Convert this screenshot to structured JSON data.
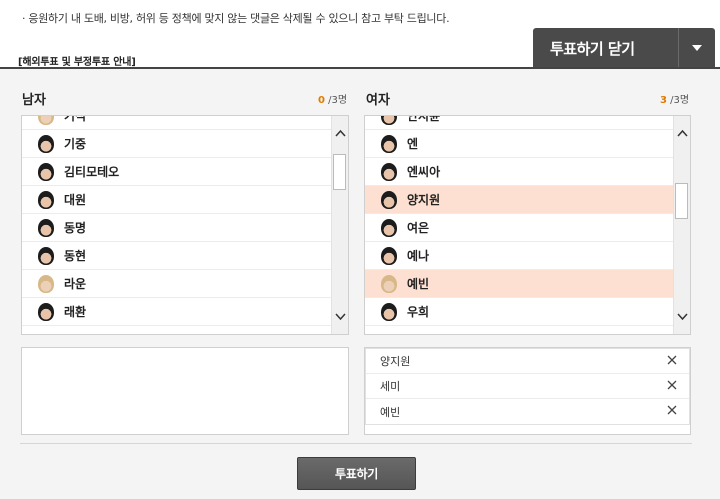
{
  "page": {
    "notice_line": "· 응원하기 내 도배, 비방, 허위 등 정책에 맞지 않는 댓글은 삭제될 수 있으니 참고 부탁 드립니다.",
    "policy_link": "[해외투표 및 부정투표 안내]"
  },
  "vote_toggle": {
    "label": "투표하기 닫기",
    "arrow_icon": "chevron-down-icon"
  },
  "male": {
    "title": "남자",
    "selected_count": "0",
    "max_label": "/3명",
    "list": [
      {
        "name": "기석",
        "selected": false
      },
      {
        "name": "기중",
        "selected": false
      },
      {
        "name": "김티모테오",
        "selected": false
      },
      {
        "name": "대원",
        "selected": false
      },
      {
        "name": "동명",
        "selected": false
      },
      {
        "name": "동현",
        "selected": false
      },
      {
        "name": "라운",
        "selected": false
      },
      {
        "name": "래환",
        "selected": false
      }
    ],
    "scroll_position": 0.23
  },
  "female": {
    "title": "여자",
    "selected_count": "3",
    "max_label": "/3명",
    "list": [
      {
        "name": "안지윤",
        "selected": false
      },
      {
        "name": "엔",
        "selected": false
      },
      {
        "name": "엔씨아",
        "selected": false
      },
      {
        "name": "양지원",
        "selected": true
      },
      {
        "name": "여은",
        "selected": false
      },
      {
        "name": "예나",
        "selected": false
      },
      {
        "name": "예빈",
        "selected": true
      },
      {
        "name": "우희",
        "selected": false
      }
    ],
    "scroll_position": 0.56,
    "picked": [
      {
        "name": "양지원"
      },
      {
        "name": "세미"
      },
      {
        "name": "예빈"
      }
    ]
  },
  "submit_label": "투표하기"
}
